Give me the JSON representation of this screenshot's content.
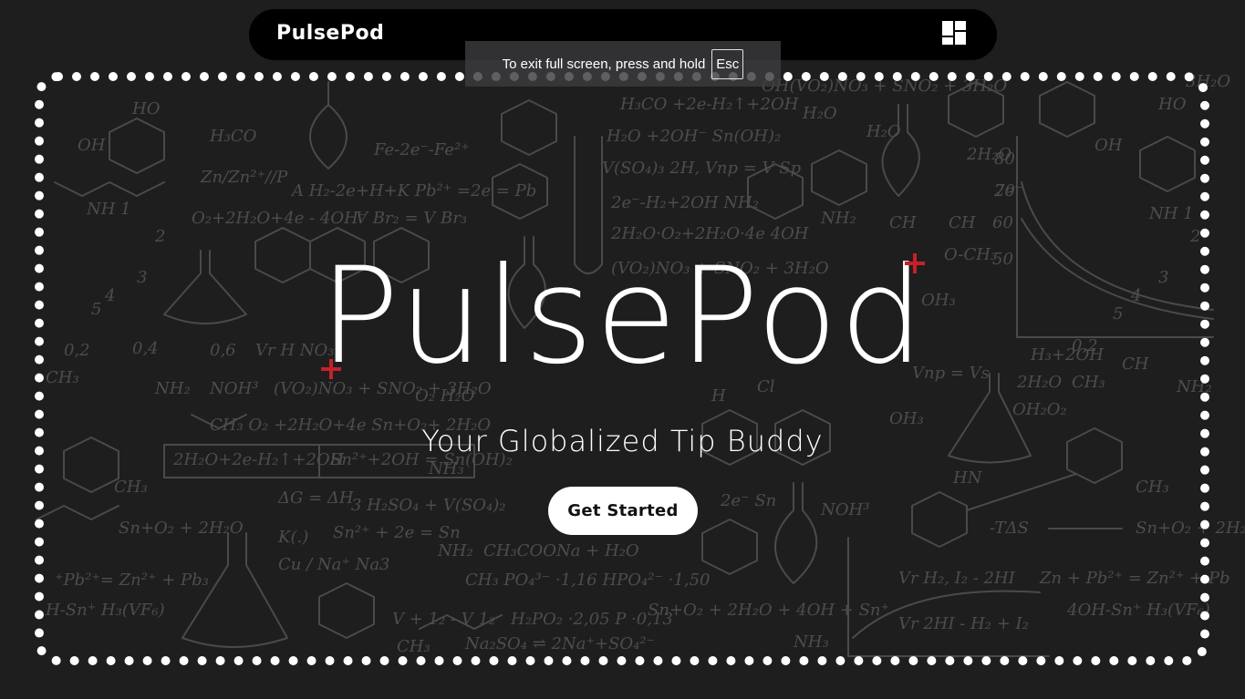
{
  "navbar": {
    "brand": "PulsePod",
    "menu_icon": "grid-menu-icon"
  },
  "fullscreen_notice": {
    "text": "To exit full screen, press and hold",
    "key": "Esc"
  },
  "hero": {
    "title": "PulsePod",
    "subtitle": "Your Globalized Tip Buddy",
    "cta_label": "Get Started"
  },
  "colors": {
    "background": "#1e1e1e",
    "navbar": "#000000",
    "accent_cross": "#c7202a",
    "text": "#ffffff"
  }
}
